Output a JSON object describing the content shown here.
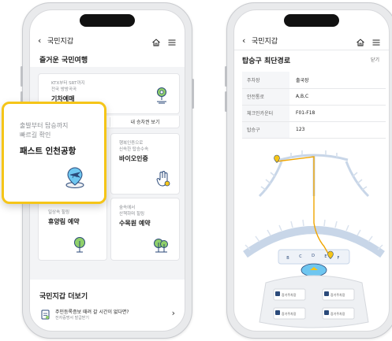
{
  "left_phone": {
    "header": {
      "title": "국민지갑"
    },
    "section_title": "즐거운 국민여행",
    "cards": [
      {
        "subtitle": "KTX부터 SRT까지\n전국 방방곡곡",
        "title": "기차예매",
        "icon": "map-pin-icon"
      },
      {
        "subtitle": "행복인증으로\n신속한 탑승수속",
        "title": "바이오인증",
        "icon": "hand-touch-icon"
      },
      {
        "subtitle": "일상속 힐링",
        "title": "휴양림 예약",
        "icon": "tree-icon"
      },
      {
        "subtitle": "숲속에서\n산책하며 힐링",
        "title": "수목원 예약",
        "icon": "tree-icon"
      }
    ],
    "ticket_button": "내 승차권 보기",
    "more_section_title": "국민지갑 더보기",
    "more_item": {
      "title": "주민등록증보 때려 갈 시간이 없다면?",
      "subtitle": "전자증명서 발급받기"
    }
  },
  "callout": {
    "subtitle_line1": "출발부터 탑승까지",
    "subtitle_line2": "빠르길 확인",
    "title": "패스트 인천공항",
    "icon": "airplane-location-icon",
    "accent": "#f5c518"
  },
  "right_phone": {
    "header": {
      "title": "국민지갑"
    },
    "page_title": "탑승구 최단경로",
    "close_label": "닫기",
    "rows": [
      {
        "key": "주차장",
        "value": "출국장"
      },
      {
        "key": "안전통로",
        "value": "A,B,C"
      },
      {
        "key": "체크인카운터",
        "value": "F01-F18"
      },
      {
        "key": "탑승구",
        "value": "123"
      }
    ],
    "map_gate_letters": [
      "B",
      "C",
      "D",
      "E",
      "F"
    ],
    "map_labels": [
      "장기주차장",
      "장기주차장",
      "장기주차장",
      "장기주차장"
    ],
    "route_color": "#f0a500"
  }
}
